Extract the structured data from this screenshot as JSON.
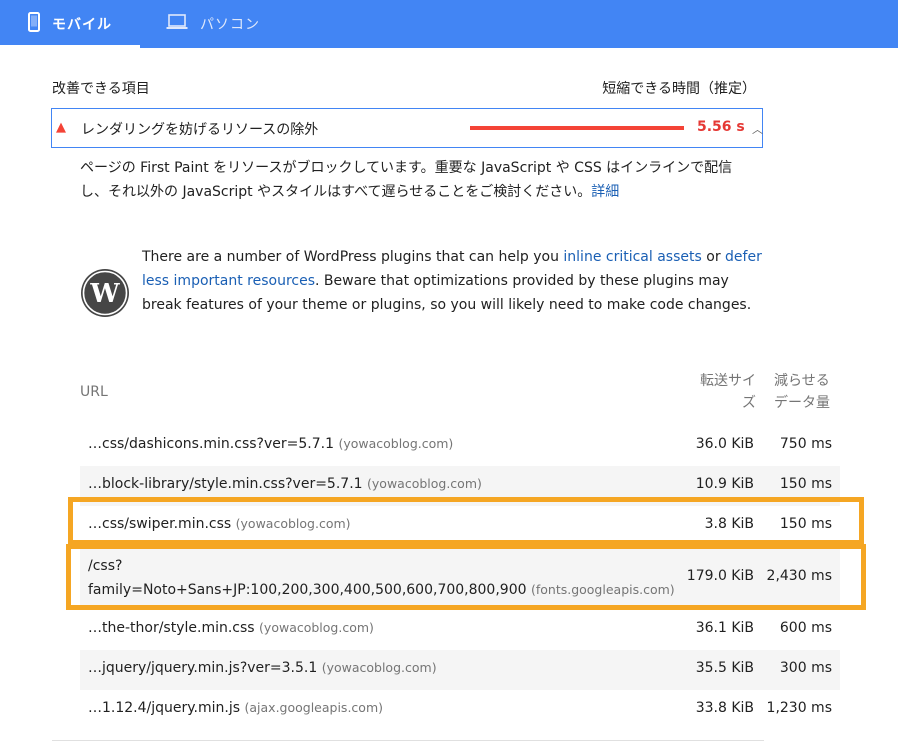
{
  "tabs": [
    {
      "label": "モバイル",
      "icon": "smartphone-icon",
      "active": true
    },
    {
      "label": "パソコン",
      "icon": "laptop-icon",
      "active": false
    }
  ],
  "section": {
    "left_label": "改善できる項目",
    "right_label": "短縮できる時間（推定）"
  },
  "audit": {
    "title": "レンダリングを妨げるリソースの除外",
    "time": "5.56 s",
    "description_before": "ページの First Paint をリソースがブロックしています。重要な JavaScript や CSS はインラインで配信し、それ以外の JavaScript やスタイルはすべて遅らせることをご検討ください。",
    "description_link": "詳細"
  },
  "wordpress": {
    "text_1": "There are a number of WordPress plugins that can help you ",
    "link_1": "inline critical assets",
    "text_2": " or ",
    "link_2": "defer less important resources",
    "text_3": ". Beware that optimizations provided by these plugins may break features of your theme or plugins, so you will likely need to make code changes."
  },
  "table": {
    "headers": {
      "url": "URL",
      "size_line1": "転送サイ",
      "size_line2": "ズ",
      "savings_line1": "減らせる",
      "savings_line2": "データ量"
    },
    "rows": [
      {
        "url": "…css/dashicons.min.css?ver=5.7.1",
        "domain": "(yowacoblog.com)",
        "size": "36.0 KiB",
        "savings": "750 ms"
      },
      {
        "url": "…block-library/style.min.css?ver=5.7.1",
        "domain": "(yowacoblog.com)",
        "size": "10.9 KiB",
        "savings": "150 ms"
      },
      {
        "url": "…css/swiper.min.css",
        "domain": "(yowacoblog.com)",
        "size": "3.8 KiB",
        "savings": "150 ms"
      },
      {
        "url_line1": "/css?",
        "url_line2": "family=Noto+Sans+JP:100,200,300,400,500,600,700,800,900",
        "domain": "(fonts.googleapis.com)",
        "size": "179.0 KiB",
        "savings": "2,430 ms"
      },
      {
        "url": "…the-thor/style.min.css",
        "domain": "(yowacoblog.com)",
        "size": "36.1 KiB",
        "savings": "600 ms"
      },
      {
        "url": "…jquery/jquery.min.js?ver=3.5.1",
        "domain": "(yowacoblog.com)",
        "size": "35.5 KiB",
        "savings": "300 ms"
      },
      {
        "url": "…1.12.4/jquery.min.js",
        "domain": "(ajax.googleapis.com)",
        "size": "33.8 KiB",
        "savings": "1,230 ms"
      }
    ]
  },
  "colors": {
    "header_blue": "#4285f4",
    "fail_red": "#f44336",
    "link_blue": "#1a5fb4",
    "highlight_orange": "#f5a623"
  }
}
